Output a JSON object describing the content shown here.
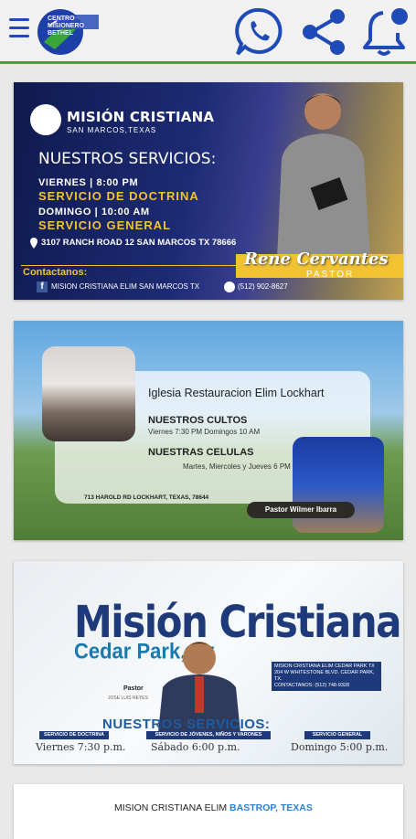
{
  "header": {
    "logo_text": "CENTRO MISIONERO BETHEL",
    "icons": [
      "menu-icon",
      "whatsapp-icon",
      "share-icon",
      "bell-icon"
    ]
  },
  "cards": [
    {
      "church": "MISIÓN CRISTIANA",
      "location": "SAN MARCOS,TEXAS",
      "heading": "NUESTROS SERVICIOS:",
      "day1": "VIERNES | 8:00 PM",
      "service1": "SERVICIO DE DOCTRINA",
      "day2": "DOMINGO | 10:00 AM",
      "service2": "SERVICIO GENERAL",
      "address": "3107 RANCH ROAD 12 SAN MARCOS TX 78666",
      "contact_label": "Contactanos:",
      "facebook": "MISION CRISTIANA ELIM SAN MARCOS TX",
      "phone": "(512) 902-8627",
      "pastor_name": "Rene Cervantes",
      "pastor_title": "PASTOR"
    },
    {
      "church": "Iglesia Restauracion Elim Lockhart",
      "cultos_label": "NUESTROS CULTOS",
      "cultos_time": "Viernes 7:30 PM Domingos 10 AM",
      "celulas_label": "NUESTRAS CELULAS",
      "celulas_time": "Martes, Miercoles y Jueves 6 PM",
      "address": "713 HAROLD RD LOCKHART, TEXAS, 78644",
      "pastor": "Pastor Wilmer Ibarra"
    },
    {
      "church": "Misión Cristiana",
      "city": "Cedar Park, Tx",
      "pastor_label": "Pastor",
      "pastor_name": "JOSE LUIS REYES",
      "facebook": "MISION CRISTIANA ELIM CEDAR PARK TX",
      "address": "204 W WHITESTONE BLVD. CEDAR PARK, TX.",
      "contact": "CONTACTANOS: (512) 748-9328",
      "heading": "NUESTROS SERVICIOS:",
      "s1_label": "SERVICIO DE DOCTRINA",
      "s1_time": "Viernes 7:30 p.m.",
      "s2_label": "SERVICIO DE JÓVENES, NIÑOS Y VARONES",
      "s2_time": "Sábado 6:00 p.m.",
      "s3_label": "SERVICIO GENERAL",
      "s3_time": "Domingo 5:00 p.m."
    },
    {
      "church": "MISION CRISTIANA ELIM",
      "city": "BASTROP, TEXAS"
    }
  ],
  "colors": {
    "accent_green": "#3aa63a",
    "brand_blue": "#1f4bb8",
    "gold": "#f1c232"
  }
}
